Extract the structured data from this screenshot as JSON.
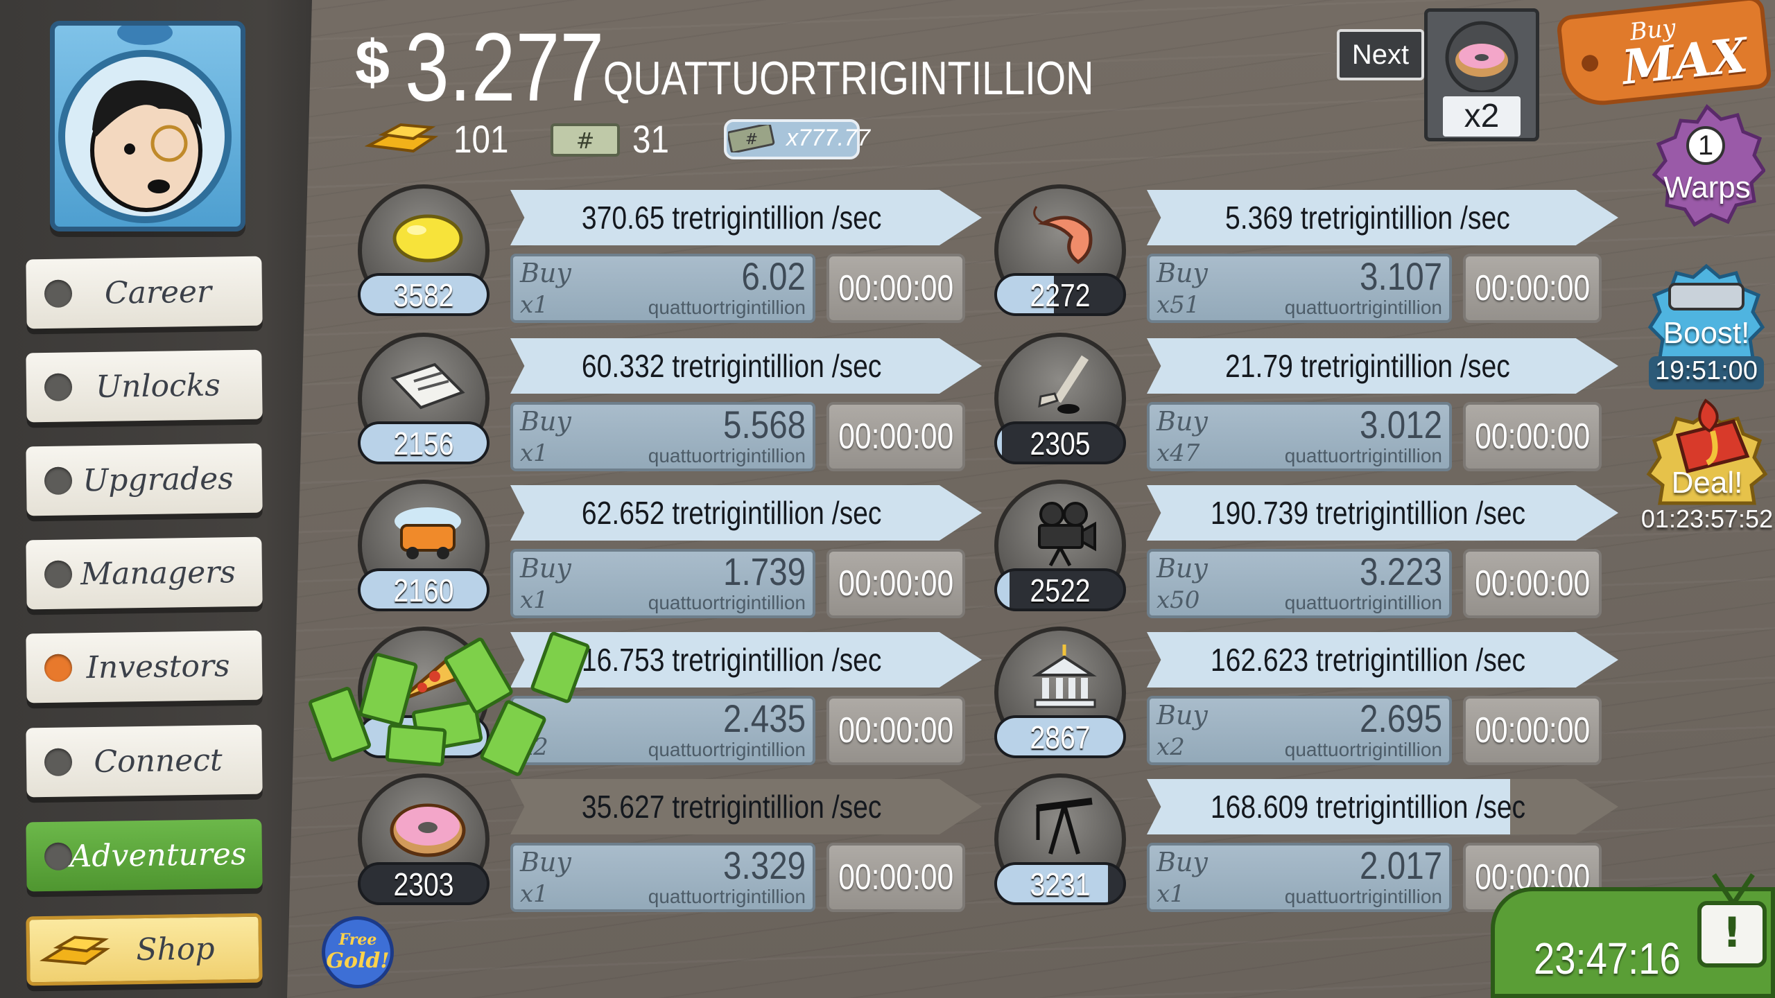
{
  "sidebar": {
    "nav": [
      {
        "label": "Career",
        "active": false
      },
      {
        "label": "Unlocks",
        "active": false
      },
      {
        "label": "Upgrades",
        "active": false
      },
      {
        "label": "Managers",
        "active": false
      },
      {
        "label": "Investors",
        "active": true
      },
      {
        "label": "Connect",
        "active": false
      },
      {
        "label": "Adventures",
        "active": false
      },
      {
        "label": "Shop",
        "active": false
      }
    ]
  },
  "header": {
    "currency_symbol": "$",
    "money_value": "3.277",
    "money_unit": "QUATTUORTRIGINTILLION",
    "gold_count": "101",
    "megabucks_count": "31",
    "megabucks_multiplier": "x777.77"
  },
  "businesses": [
    {
      "icon": "lemon-icon",
      "owned": "3582",
      "rate": "370.65 tretrigintillion /sec",
      "buy_word": "Buy",
      "buy_mult": "x1",
      "cost": "6.02",
      "cost_unit": "quattuortrigintillion",
      "timer": "00:00:00",
      "progress": 1.0
    },
    {
      "icon": "shrimp-icon",
      "owned": "2272",
      "rate": "5.369 tretrigintillion /sec",
      "buy_word": "Buy",
      "buy_mult": "x51",
      "cost": "3.107",
      "cost_unit": "quattuortrigintillion",
      "timer": "00:00:00",
      "progress": 1.0
    },
    {
      "icon": "newspaper-icon",
      "owned": "2156",
      "rate": "60.332 tretrigintillion /sec",
      "buy_word": "Buy",
      "buy_mult": "x1",
      "cost": "5.568",
      "cost_unit": "quattuortrigintillion",
      "timer": "00:00:00",
      "progress": 1.0
    },
    {
      "icon": "hockey-icon",
      "owned": "2305",
      "rate": "21.79 tretrigintillion /sec",
      "buy_word": "Buy",
      "buy_mult": "x47",
      "cost": "3.012",
      "cost_unit": "quattuortrigintillion",
      "timer": "00:00:00",
      "progress": 1.0
    },
    {
      "icon": "car-wash-icon",
      "owned": "2160",
      "rate": "62.652 tretrigintillion /sec",
      "buy_word": "Buy",
      "buy_mult": "x1",
      "cost": "1.739",
      "cost_unit": "quattuortrigintillion",
      "timer": "00:00:00",
      "progress": 1.0
    },
    {
      "icon": "movie-camera-icon",
      "owned": "2522",
      "rate": "190.739 tretrigintillion /sec",
      "buy_word": "Buy",
      "buy_mult": "x50",
      "cost": "3.223",
      "cost_unit": "quattuortrigintillion",
      "timer": "00:00:00",
      "progress": 1.0
    },
    {
      "icon": "pizza-icon",
      "owned": "",
      "rate": "16.753 tretrigintillion /sec",
      "buy_word": "",
      "buy_mult": "x2",
      "cost": "2.435",
      "cost_unit": "quattuortrigintillion",
      "timer": "00:00:00",
      "progress": 1.0
    },
    {
      "icon": "bank-icon",
      "owned": "2867",
      "rate": "162.623 tretrigintillion /sec",
      "buy_word": "Buy",
      "buy_mult": "x2",
      "cost": "2.695",
      "cost_unit": "quattuortrigintillion",
      "timer": "00:00:00",
      "progress": 1.0
    },
    {
      "icon": "donut-icon",
      "owned": "2303",
      "rate": "35.627 tretrigintillion /sec",
      "buy_word": "Buy",
      "buy_mult": "x1",
      "cost": "3.329",
      "cost_unit": "quattuortrigintillion",
      "timer": "00:00:00",
      "progress": 0.0
    },
    {
      "icon": "oil-derrick-icon",
      "owned": "3231",
      "rate": "168.609 tretrigintillion /sec",
      "buy_word": "Buy",
      "buy_mult": "x1",
      "cost": "2.017",
      "cost_unit": "quattuortrigintillion",
      "timer": "00:00:00",
      "progress": 0.77
    }
  ],
  "right": {
    "next_label": "Next",
    "next_multiplier": "x2",
    "buy_small": "Buy",
    "buy_big": "MAX",
    "warps_count": "1",
    "warps_label": "Warps",
    "boost_label": "Boost!",
    "boost_timer": "19:51:00",
    "deal_label": "Deal!",
    "deal_timer": "01:23:57:52",
    "clock": "23:47:16",
    "free_gold_line1": "Free",
    "free_gold_line2": "Gold!",
    "alert_symbol": "!"
  },
  "colors": {
    "accent_orange": "#e07a2b",
    "adventures_green": "#5aa33a",
    "shop_yellow": "#f6e08a",
    "investor_dot": "#e8792c"
  }
}
